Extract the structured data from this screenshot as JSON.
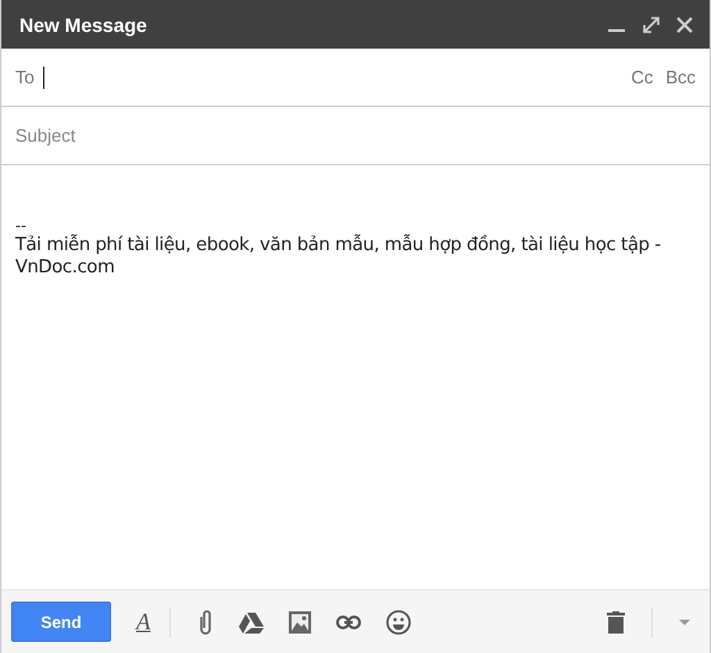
{
  "window": {
    "title": "New Message"
  },
  "to": {
    "label": "To",
    "cc": "Cc",
    "bcc": "Bcc"
  },
  "subject": {
    "placeholder": "Subject"
  },
  "body": {
    "separator": "--",
    "signature": "Tải miễn phí tài liệu, ebook, văn bản mẫu, mẫu hợp đồng, tài liệu học tập - VnDoc.com"
  },
  "toolbar": {
    "send": "Send",
    "formatting": "A"
  }
}
